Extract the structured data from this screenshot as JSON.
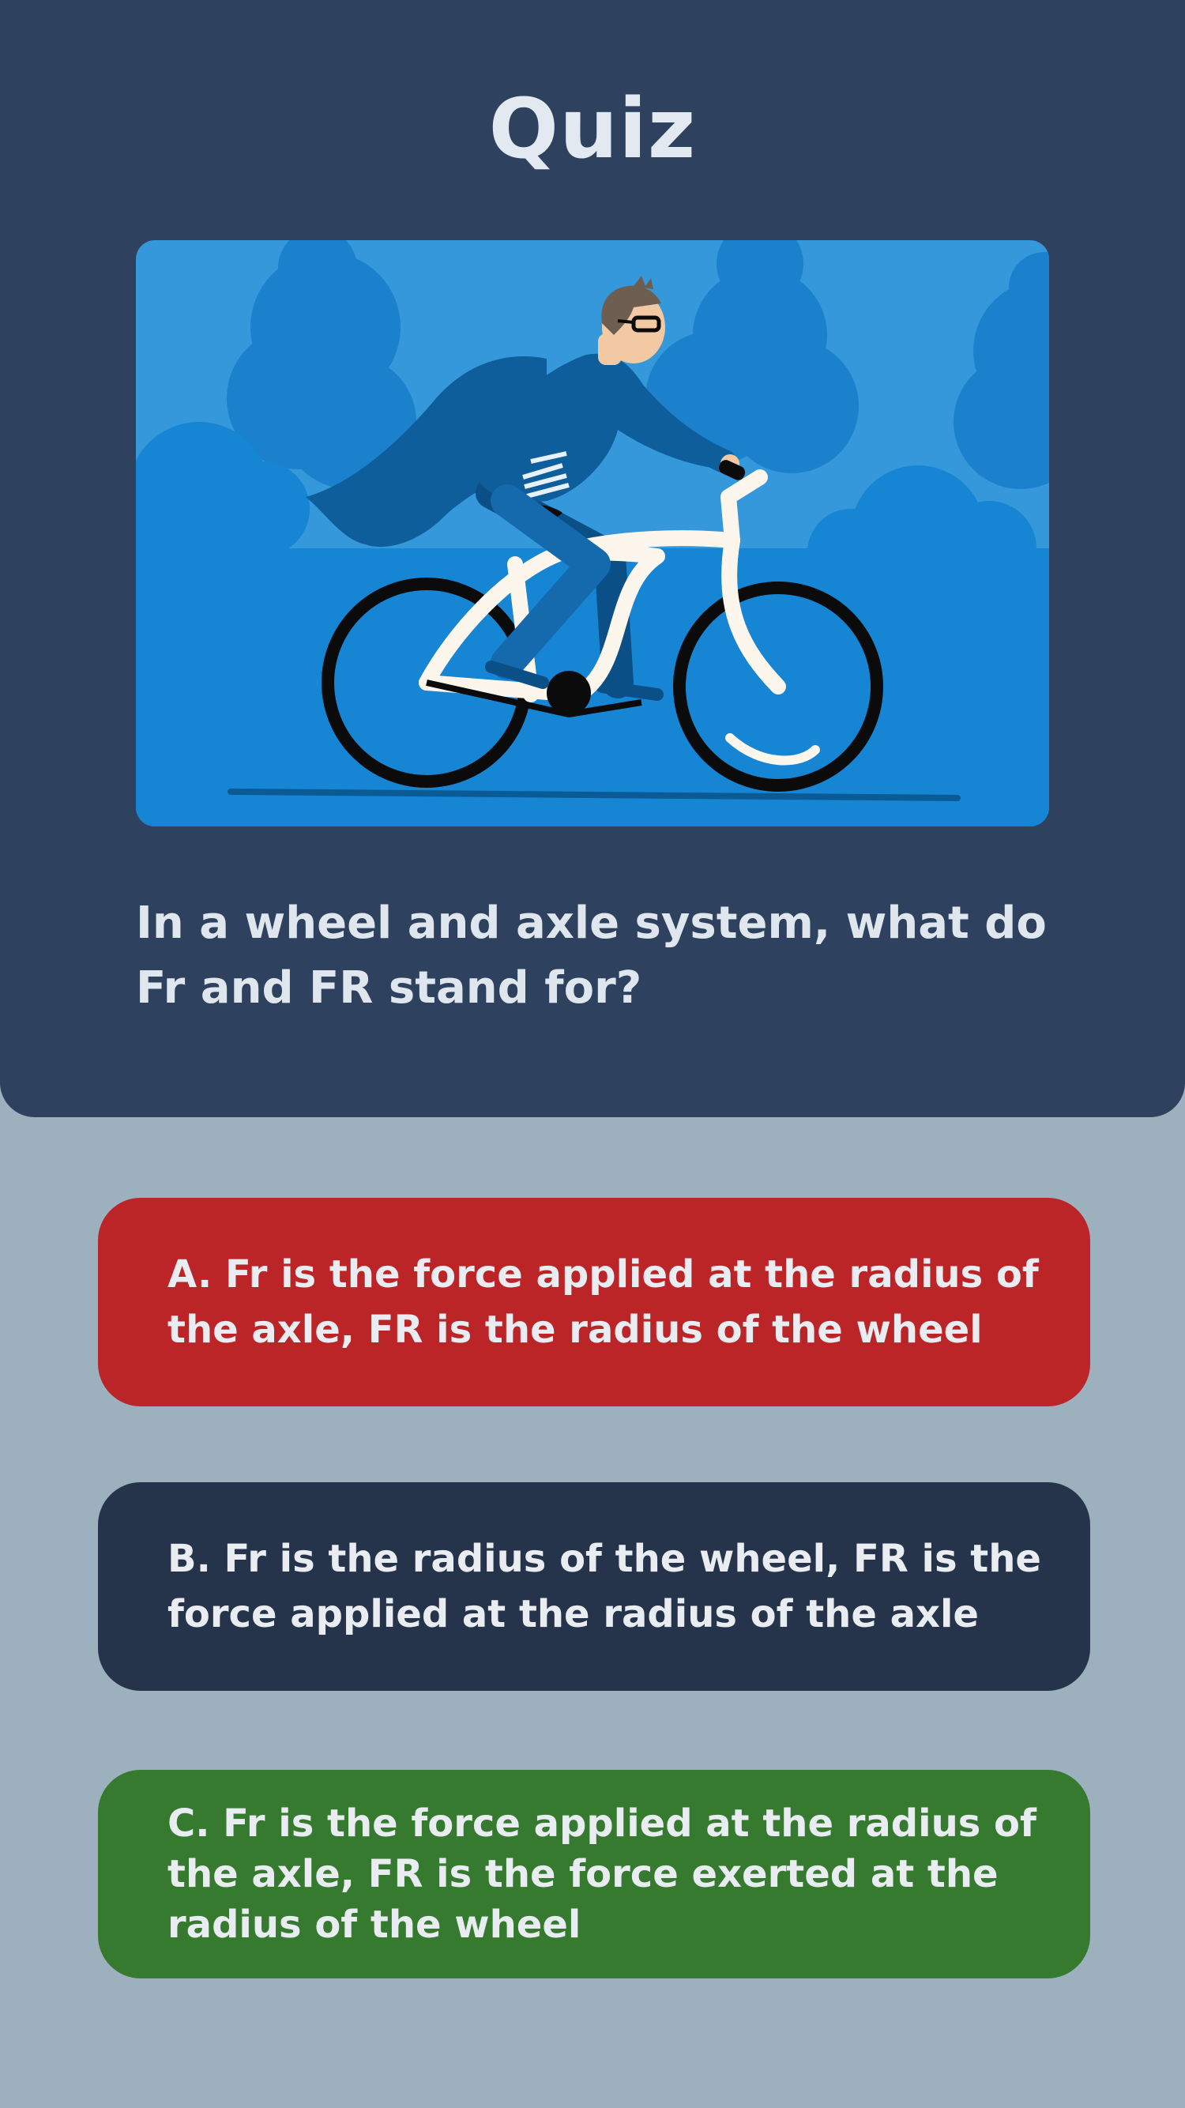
{
  "page": {
    "title": "Quiz"
  },
  "illustration": {
    "subject": "person-riding-bicycle",
    "colors": {
      "background": "#3498db",
      "trees": "#1685d3",
      "bike_frame": "#fdf6ec",
      "tires": "#0b0b0b",
      "rider_coat": "#0f5e9c"
    }
  },
  "question": {
    "text": "In a wheel and axle system, what do Fr and FR stand for?"
  },
  "options": [
    {
      "label": "A. Fr is the force applied at the radius of the axle, FR is the radius of the wheel",
      "color": "#bb2528"
    },
    {
      "label": "B. Fr is the radius of the wheel, FR is the force applied at the radius  of the axle",
      "color": "#26344b"
    },
    {
      "label": "C. Fr is the force applied at the radius of the axle, FR is the force exerted at the radius of the wheel",
      "color": "#357a2f"
    }
  ],
  "theme": {
    "header_bg": "#2e4260",
    "page_bg": "#9cb0bd",
    "text": "#e3e9f1"
  }
}
